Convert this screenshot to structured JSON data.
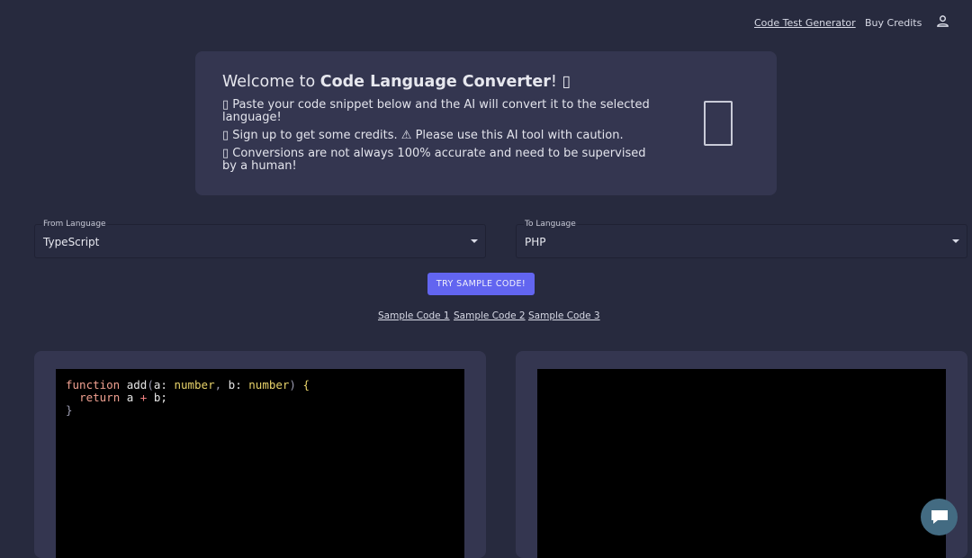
{
  "nav": {
    "generator_label": "Code Test Generator",
    "credits_label": "Buy Credits",
    "account_icon": "account-icon"
  },
  "welcome": {
    "title_prefix": "Welcome to ",
    "title_brand": "Code Language Converter",
    "title_suffix": "! ▯",
    "line1": "▯ Paste your code snippet below and the AI will convert it to the selected language!",
    "line2": "▯ Sign up to get some credits. ⚠ Please use this AI tool with caution.",
    "line3": "▯ Conversions are not always 100% accurate and need to be supervised by a human!",
    "emoji_icon": "missing-glyph-icon"
  },
  "from_language": {
    "label": "From Language",
    "value": "TypeScript"
  },
  "to_language": {
    "label": "To Language",
    "value": "PHP"
  },
  "try_sample_label": "TRY SAMPLE CODE!",
  "samples": [
    "Sample Code 1",
    "Sample Code 2",
    "Sample Code 3"
  ],
  "input_code": {
    "line1": {
      "kw": "function",
      "name": " add",
      "p1": "(",
      "a": "a",
      "c1": ": ",
      "t1": "number",
      "comma": ",",
      "b": " b",
      "c2": ": ",
      "t2": "number",
      "p2": ")",
      "brace": " {"
    },
    "line2": {
      "indent": "  ",
      "kw": "return",
      "expr1": " a ",
      "op": "+",
      "expr2": " b;"
    },
    "line3": "}"
  },
  "output_code": "",
  "colors": {
    "background": "#272a3e",
    "card": "#343650",
    "accent": "#6265f0",
    "chat": "#436b82"
  }
}
